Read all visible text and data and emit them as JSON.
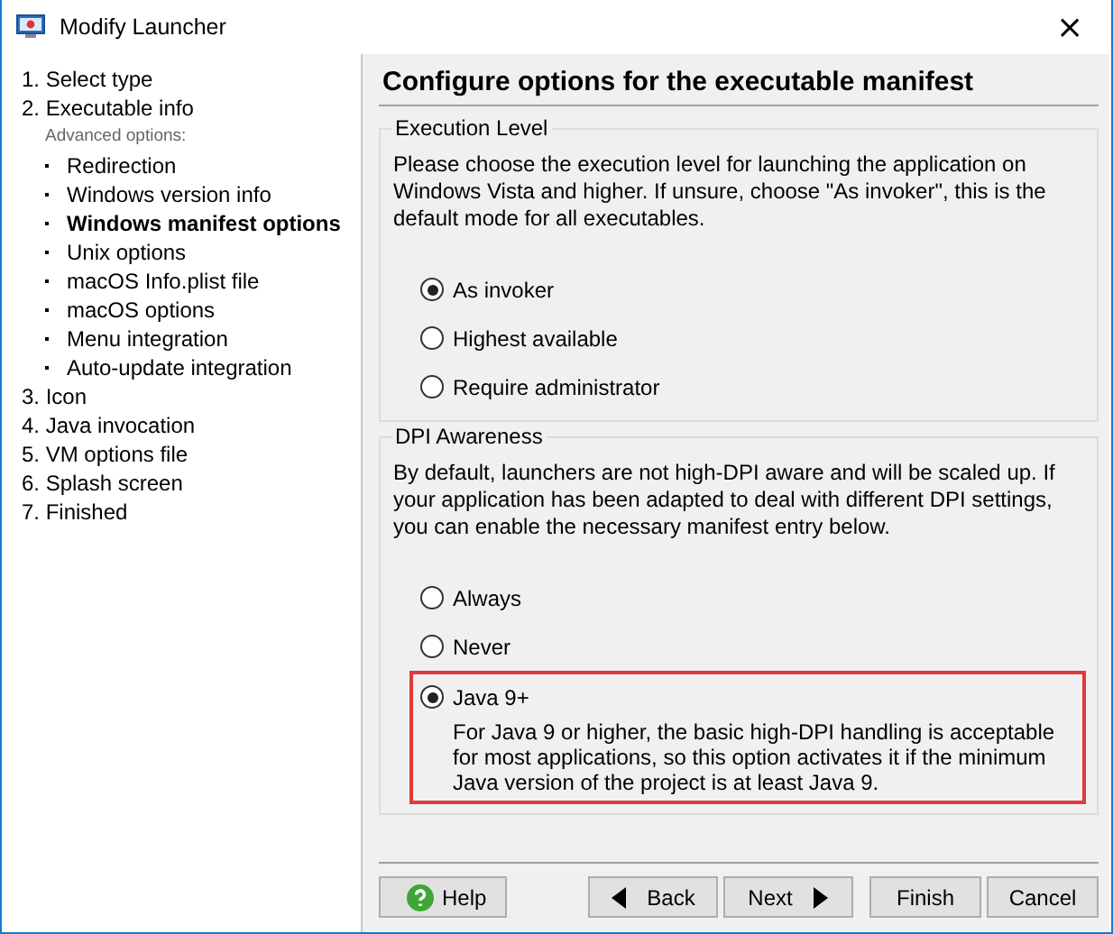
{
  "window": {
    "title": "Modify Launcher",
    "close": "×"
  },
  "sidebar": {
    "steps": [
      {
        "label": "1. Select type",
        "selected": false
      },
      {
        "label": "2. Executable info",
        "selected": false,
        "section_label": "Advanced options:",
        "children": [
          {
            "label": "Redirection",
            "selected": false
          },
          {
            "label": "Windows version info",
            "selected": false
          },
          {
            "label": "Windows manifest options",
            "selected": true
          },
          {
            "label": "Unix options",
            "selected": false
          },
          {
            "label": "macOS Info.plist file",
            "selected": false
          },
          {
            "label": "macOS options",
            "selected": false
          },
          {
            "label": "Menu integration",
            "selected": false
          },
          {
            "label": "Auto-update integration",
            "selected": false
          }
        ]
      },
      {
        "label": "3. Icon",
        "selected": false
      },
      {
        "label": "4. Java invocation",
        "selected": false
      },
      {
        "label": "5. VM options file",
        "selected": false
      },
      {
        "label": "6. Splash screen",
        "selected": false
      },
      {
        "label": "7. Finished",
        "selected": false
      }
    ]
  },
  "page_title": "Configure options for the executable manifest",
  "groups": [
    {
      "title": "Execution Level",
      "description": "Please choose the execution level for launching the application on Windows Vista and higher. If unsure, choose \"As invoker\", this is the default mode for all executables.",
      "options": [
        {
          "label": "As invoker",
          "selected": true,
          "highlighted": false
        },
        {
          "label": "Highest available",
          "selected": false,
          "highlighted": false
        },
        {
          "label": "Require administrator",
          "selected": false,
          "highlighted": false
        }
      ]
    },
    {
      "title": "DPI Awareness",
      "description": "By default, launchers are not high-DPI aware and will be scaled up. If your application has been adapted to deal with different DPI settings, you can enable the necessary manifest entry below.",
      "options": [
        {
          "label": "Always",
          "selected": false,
          "highlighted": false
        },
        {
          "label": "Never",
          "selected": false,
          "highlighted": false
        },
        {
          "label": "Java 9+",
          "selected": true,
          "highlighted": true,
          "description": "For Java 9 or higher, the basic high-DPI handling is acceptable for most applications, so this option activates it if the minimum Java version of the project is at least Java 9."
        }
      ]
    }
  ],
  "buttons": [
    {
      "kind": "help",
      "label": "Help",
      "disabled": false
    },
    {
      "kind": "back",
      "label": "Back",
      "disabled": false
    },
    {
      "kind": "next",
      "label": "Next",
      "disabled": false
    },
    {
      "kind": "plain",
      "label": "Finish",
      "disabled": false
    },
    {
      "kind": "plain",
      "label": "Cancel",
      "disabled": false
    }
  ]
}
